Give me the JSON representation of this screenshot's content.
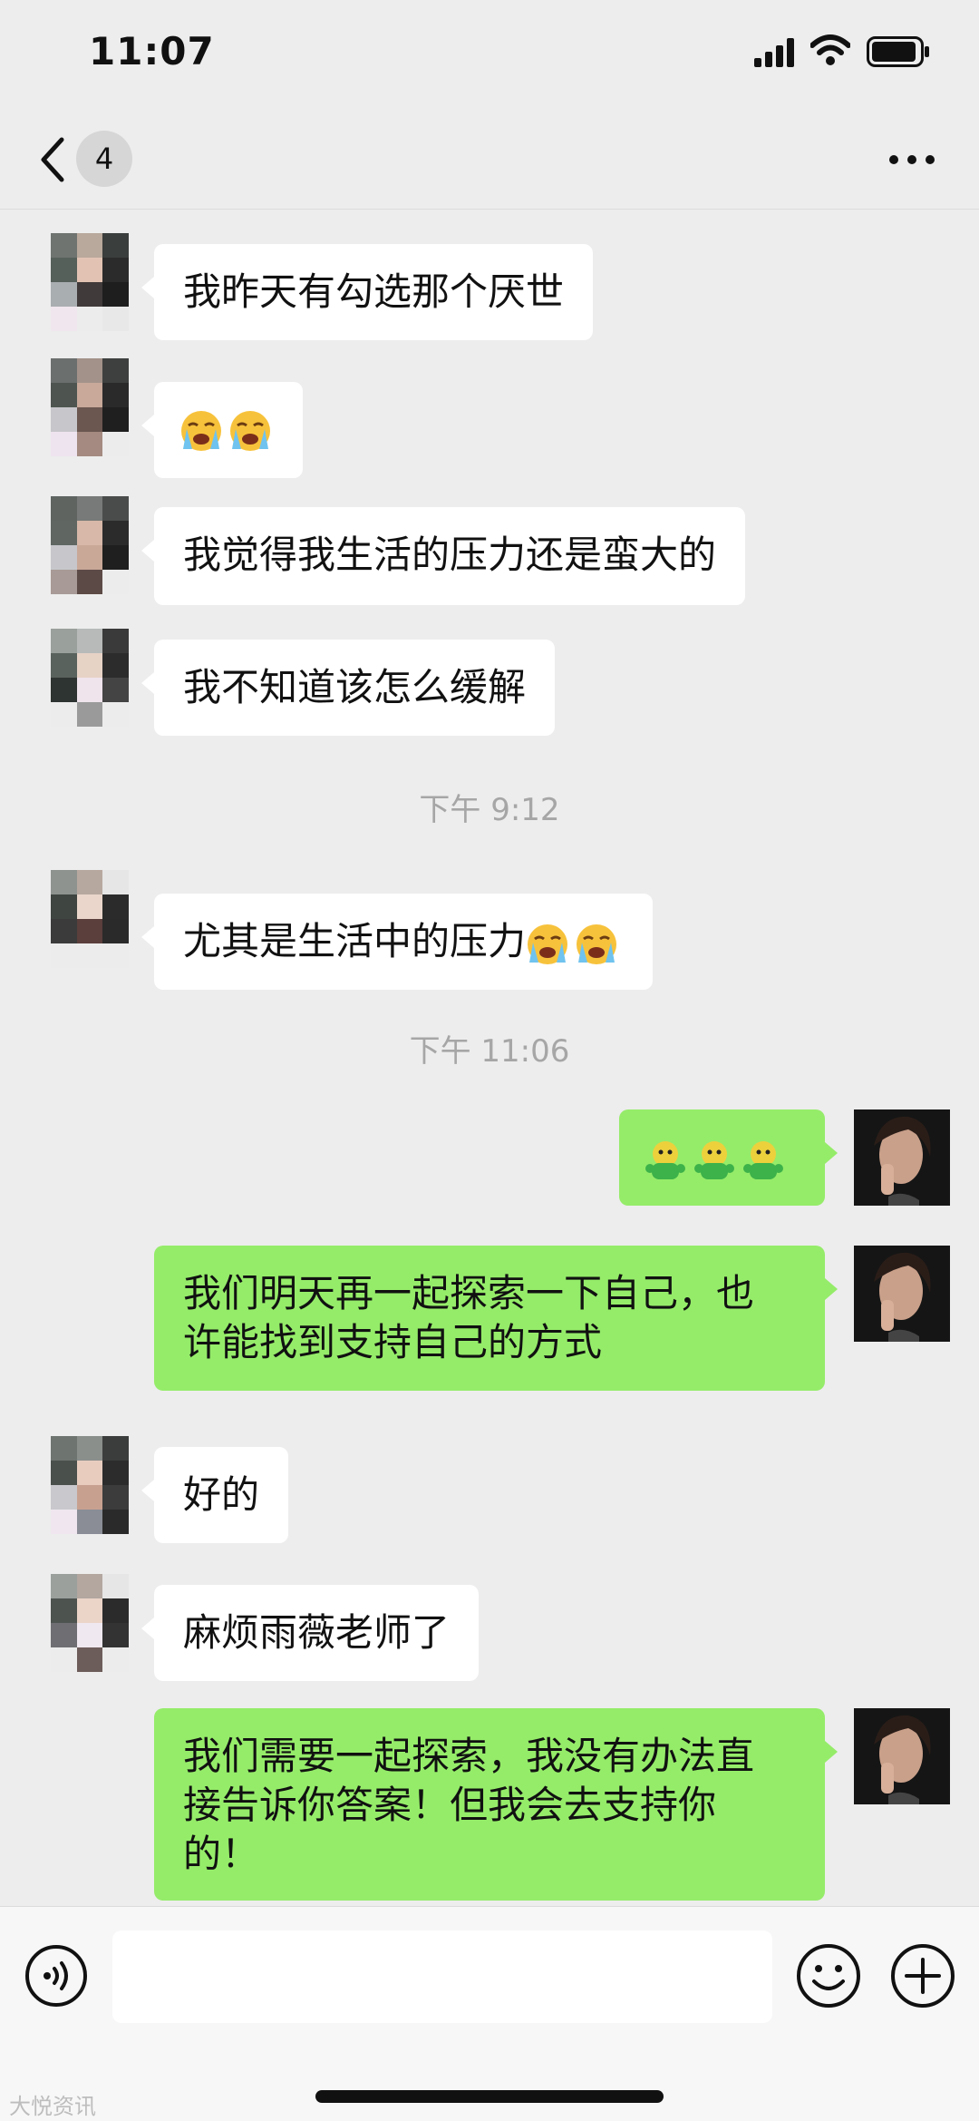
{
  "status_bar": {
    "time": "11:07"
  },
  "nav": {
    "unread_count": "4"
  },
  "messages": [
    {
      "side": "in",
      "text": "我昨天有勾选那个厌世"
    },
    {
      "side": "in",
      "emoji": [
        "loudly-crying-face",
        "loudly-crying-face"
      ]
    },
    {
      "side": "in",
      "text": "我觉得我生活的压力还是蛮大的"
    },
    {
      "side": "in",
      "text": "我不知道该怎么缓解"
    },
    {
      "side": "time",
      "text": "下午 9:12"
    },
    {
      "side": "in",
      "text": "尤其是生活中的压力",
      "emoji": [
        "loudly-crying-face",
        "loudly-crying-face"
      ]
    },
    {
      "side": "time",
      "text": "下午 11:06"
    },
    {
      "side": "out",
      "emoji": [
        "frog-sticker",
        "frog-sticker",
        "frog-sticker"
      ]
    },
    {
      "side": "out",
      "text_lines": [
        "我们明天再一起探索一下自己，也",
        "许能找到支持自己的方式"
      ]
    },
    {
      "side": "in",
      "text": "好的"
    },
    {
      "side": "in",
      "text": "麻烦雨薇老师了"
    },
    {
      "side": "out",
      "text_lines": [
        "我们需要一起探索，我没有办法直",
        "接告诉你答案！但我会去支持你",
        "的！"
      ]
    }
  ],
  "input": {
    "placeholder": ""
  },
  "watermark": "大悦资讯",
  "colors": {
    "background": "#ededed",
    "incoming_bubble": "#ffffff",
    "outgoing_bubble": "#95ec69",
    "timestamp": "#a6a6a6"
  }
}
